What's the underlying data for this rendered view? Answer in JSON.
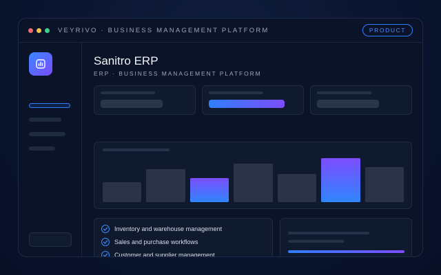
{
  "window": {
    "title": "VEYRIVO · BUSINESS MANAGEMENT PLATFORM",
    "badge": "PRODUCT"
  },
  "sidebar": {
    "app_icon": "bar-chart-icon",
    "nav_count": 4
  },
  "main": {
    "title": "Sanitro ERP",
    "subtitle": "ERP · BUSINESS MANAGEMENT PLATFORM"
  },
  "features": [
    "Inventory and warehouse management",
    "Sales and purchase workflows",
    "Customer and supplier management"
  ],
  "chart_data": {
    "type": "bar",
    "values": [
      27,
      44,
      32,
      52,
      38,
      59,
      47
    ],
    "highlighted": [
      2,
      5
    ],
    "ylim": [
      0,
      60
    ]
  },
  "colors": {
    "accent_blue": "#2f7fff",
    "accent_violet": "#7c4dff",
    "dot_red": "#ef6b6b",
    "dot_yellow": "#f2c14e",
    "dot_green": "#3fd08c"
  }
}
